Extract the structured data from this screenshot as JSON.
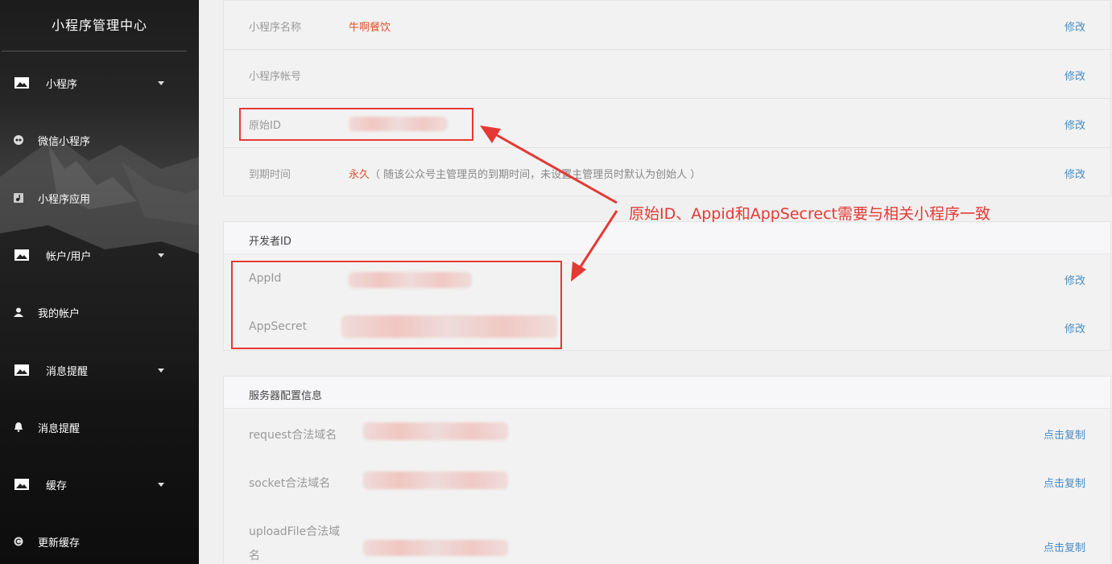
{
  "sidebar": {
    "title": "小程序管理中心",
    "items": [
      {
        "label": "小程序",
        "icon": "image-icon",
        "type": "group"
      },
      {
        "label": "微信小程序",
        "icon": "wechat-icon",
        "type": "sub"
      },
      {
        "label": "小程序应用",
        "icon": "music-icon",
        "type": "sub"
      },
      {
        "label": "帐户/用户",
        "icon": "image-icon",
        "type": "group"
      },
      {
        "label": "我的帐户",
        "icon": "user-icon",
        "type": "sub"
      },
      {
        "label": "消息提醒",
        "icon": "image-icon",
        "type": "group"
      },
      {
        "label": "消息提醒",
        "icon": "bell-icon",
        "type": "sub"
      },
      {
        "label": "缓存",
        "icon": "image-icon",
        "type": "group"
      },
      {
        "label": "更新缓存",
        "icon": "copyright-icon",
        "type": "sub"
      }
    ]
  },
  "basic_info": {
    "rows": [
      {
        "label": "小程序名称",
        "value": "牛啊餐饮",
        "action": "修改"
      },
      {
        "label": "小程序帐号",
        "value": "",
        "action": "修改"
      },
      {
        "label": "原始ID",
        "value": "",
        "action": "修改"
      },
      {
        "label": "到期时间",
        "value": "永久",
        "note": "（ 随该公众号主管理员的到期时间，未设置主管理员时默认为创始人 ）",
        "action": "修改"
      }
    ]
  },
  "developer": {
    "header": "开发者ID",
    "rows": [
      {
        "label": "AppId",
        "action": "修改"
      },
      {
        "label": "AppSecret",
        "action": "修改"
      }
    ]
  },
  "server": {
    "header": "服务器配置信息",
    "rows": [
      {
        "label": "request合法域名",
        "action": "点击复制"
      },
      {
        "label": "socket合法域名",
        "action": "点击复制"
      },
      {
        "label_line1": "uploadFile合法域",
        "label_line2": "名",
        "action": "点击复制"
      }
    ]
  },
  "annotation": {
    "text": "原始ID、Appid和AppSecrect需要与相关小程序一致",
    "color": "#e53935"
  },
  "colors": {
    "accent_link": "#4a8bc2",
    "value_red": "#e0502c",
    "annotation_red": "#e53935"
  }
}
